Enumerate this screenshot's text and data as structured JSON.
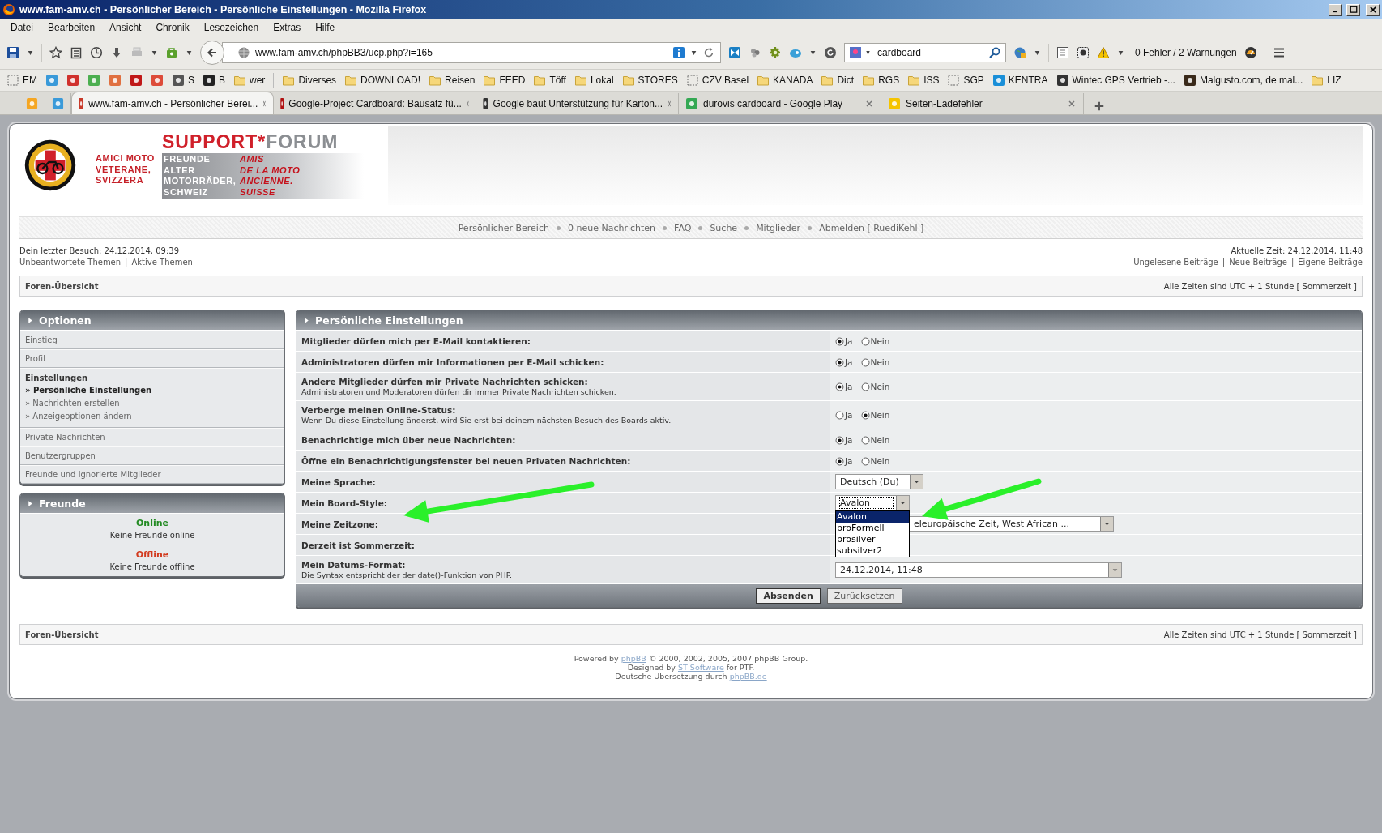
{
  "window": {
    "title": "www.fam-amv.ch - Persönlicher Bereich - Persönliche Einstellungen - Mozilla Firefox"
  },
  "menu": [
    "Datei",
    "Bearbeiten",
    "Ansicht",
    "Chronik",
    "Lesezeichen",
    "Extras",
    "Hilfe"
  ],
  "navigation_bar": {
    "url": "www.fam-amv.ch/phpBB3/ucp.php?i=165",
    "search": "cardboard",
    "status": "0 Fehler / 2 Warnungen"
  },
  "bookmarks": [
    {
      "kind": "page",
      "label": "EM"
    },
    {
      "kind": "site",
      "color": "#3a9ad9"
    },
    {
      "kind": "site",
      "color": "#d0312d"
    },
    {
      "kind": "site",
      "color": "#4caf50"
    },
    {
      "kind": "site",
      "color": "#e07040"
    },
    {
      "kind": "site",
      "color": "#c01818"
    },
    {
      "kind": "site",
      "color": "#dd4b39"
    },
    {
      "kind": "site",
      "color": "#555555",
      "label": "S"
    },
    {
      "kind": "site",
      "color": "#222222",
      "label": "B"
    },
    {
      "kind": "folder",
      "label": "wer"
    },
    {
      "kind": "folder",
      "label": "Diverses"
    },
    {
      "kind": "folder",
      "label": "DOWNLOAD!"
    },
    {
      "kind": "folder",
      "label": "Reisen"
    },
    {
      "kind": "folder",
      "label": "FEED"
    },
    {
      "kind": "folder",
      "label": "Töff"
    },
    {
      "kind": "folder",
      "label": "Lokal"
    },
    {
      "kind": "folder",
      "label": "STORES"
    },
    {
      "kind": "page",
      "label": "CZV Basel"
    },
    {
      "kind": "folder",
      "label": "KANADA"
    },
    {
      "kind": "folder",
      "label": "Dict"
    },
    {
      "kind": "folder",
      "label": "RGS"
    },
    {
      "kind": "folder",
      "label": "ISS"
    },
    {
      "kind": "page",
      "label": "SGP"
    },
    {
      "kind": "site",
      "color": "#1a8fd8",
      "label": "KENTRA"
    },
    {
      "kind": "site",
      "color": "#333333",
      "label": "Wintec GPS Vertrieb -..."
    },
    {
      "kind": "site",
      "color": "#3a2a1a",
      "label": "Malgusto.com, de mal..."
    },
    {
      "kind": "folder",
      "label": "LIZ"
    }
  ],
  "tabs": [
    {
      "kind": "pinned",
      "color": "#f5a623",
      "selected": false
    },
    {
      "kind": "pinned",
      "color": "#3a9ad9",
      "selected": false
    },
    {
      "kind": "page",
      "color": "#c83a2a",
      "label": "www.fam-amv.ch - Persönlicher Berei...",
      "selected": true
    },
    {
      "kind": "page",
      "color": "#b01010",
      "label": "Google-Project Cardboard: Bausatz fü...",
      "selected": false
    },
    {
      "kind": "page",
      "color": "#333333",
      "label": "Google baut Unterstützung für Karton...",
      "selected": false
    },
    {
      "kind": "page",
      "color": "#34a853",
      "label": "durovis cardboard - Google Play",
      "selected": false
    },
    {
      "kind": "page",
      "color": "#f5c400",
      "label": "Seiten-Ladefehler",
      "selected": false
    }
  ],
  "forum": {
    "logo": {
      "title_part_1": "SUPPORT*",
      "title_part_2": "FORUM",
      "italian": [
        "AMICI MOTO",
        "VETERANE,",
        "SVIZZERA"
      ],
      "german": [
        "FREUNDE",
        "ALTER",
        "MOTORRÄDER,",
        "SCHWEIZ"
      ],
      "french": [
        "AMIS",
        "DE LA MOTO",
        "ANCIENNE.",
        "SUISSE"
      ]
    },
    "nav_links": [
      "Persönlicher Bereich",
      "0 neue Nachrichten",
      "FAQ",
      "Suche",
      "Mitglieder",
      "Abmelden [ RuediKehl ]"
    ],
    "last_visit": "Dein letzter Besuch: 24.12.2014, 09:39",
    "current_time": "Aktuelle Zeit: 24.12.2014, 11:48",
    "link_separator": "|",
    "left_links": [
      "Unbeantwortete Themen",
      "Aktive Themen"
    ],
    "right_links": [
      "Ungelesene Beiträge",
      "Neue Beiträge",
      "Eigene Beiträge"
    ],
    "breadcrumb": "Foren-Übersicht",
    "timezone_note": "Alle Zeiten sind UTC + 1 Stunde [ Sommerzeit ]"
  },
  "sidebar": {
    "title": "Optionen",
    "items": [
      {
        "label": "Einstieg",
        "selected": false
      },
      {
        "label": "Profil",
        "selected": false
      },
      {
        "label": "Einstellungen",
        "selected": true,
        "children": [
          {
            "marker": "»",
            "label": "Persönliche Einstellungen",
            "selected": true
          },
          {
            "marker": "»",
            "label": "Nachrichten erstellen",
            "selected": false
          },
          {
            "marker": "»",
            "label": "Anzeigeoptionen ändern",
            "selected": false
          }
        ]
      },
      {
        "label": "Private Nachrichten",
        "selected": false
      },
      {
        "label": "Benutzergruppen",
        "selected": false
      },
      {
        "label": "Freunde und ignorierte Mitglieder",
        "selected": false
      }
    ]
  },
  "friends": {
    "title": "Freunde",
    "groups": [
      {
        "kind": "online",
        "heading": "Online",
        "text": "Keine Freunde online"
      },
      {
        "kind": "offline",
        "heading": "Offline",
        "text": "Keine Freunde offline"
      }
    ]
  },
  "settings": {
    "title": "Persönliche Einstellungen",
    "rows": [
      {
        "kind": "radio",
        "label": "Mitglieder dürfen mich per E-Mail kontaktieren:",
        "options": [
          {
            "label": "Ja",
            "selected": true
          },
          {
            "label": "Nein",
            "selected": false
          }
        ]
      },
      {
        "kind": "radio",
        "label": "Administratoren dürfen mir Informationen per E-Mail schicken:",
        "options": [
          {
            "label": "Ja",
            "selected": true
          },
          {
            "label": "Nein",
            "selected": false
          }
        ]
      },
      {
        "kind": "radio",
        "label": "Andere Mitglieder dürfen mir Private Nachrichten schicken:",
        "hint": "Administratoren und Moderatoren dürfen dir immer Private Nachrichten schicken.",
        "options": [
          {
            "label": "Ja",
            "selected": true
          },
          {
            "label": "Nein",
            "selected": false
          }
        ]
      },
      {
        "kind": "radio",
        "label": "Verberge meinen Online-Status:",
        "hint": "Wenn Du diese Einstellung änderst, wird Sie erst bei deinem nächsten Besuch des Boards aktiv.",
        "options": [
          {
            "label": "Ja",
            "selected": false
          },
          {
            "label": "Nein",
            "selected": true
          }
        ]
      },
      {
        "kind": "radio",
        "label": "Benachrichtige mich über neue Nachrichten:",
        "options": [
          {
            "label": "Ja",
            "selected": true
          },
          {
            "label": "Nein",
            "selected": false
          }
        ]
      },
      {
        "kind": "radio",
        "label": "Öffne ein Benachrichtigungsfenster bei neuen Privaten Nachrichten:",
        "options": [
          {
            "label": "Ja",
            "selected": true
          },
          {
            "label": "Nein",
            "selected": false
          }
        ]
      },
      {
        "kind": "select",
        "label": "Meine Sprache:",
        "value": "Deutsch (Du)",
        "expanded": false
      },
      {
        "kind": "select",
        "label": "Mein Board-Style:",
        "value": "Avalon",
        "expanded": true,
        "options": [
          {
            "label": "Avalon",
            "selected": true
          },
          {
            "label": "proFormell",
            "selected": false
          },
          {
            "label": "prosilver",
            "selected": false
          },
          {
            "label": "subsilver2",
            "selected": false
          }
        ]
      },
      {
        "kind": "select",
        "label": "Meine Zeitzone:",
        "value": "eleuropäische Zeit, West African ...",
        "expanded": false
      },
      {
        "kind": "plain",
        "label": "Derzeit ist Sommerzeit:"
      },
      {
        "kind": "select",
        "label": "Mein Datums-Format:",
        "hint": "Die Syntax entspricht der der date()-Funktion von PHP.",
        "value": "24.12.2014, 11:48",
        "expanded": false
      }
    ],
    "buttons": [
      {
        "label": "Absenden",
        "kind": "primary"
      },
      {
        "label": "Zurücksetzen",
        "kind": "secondary"
      }
    ]
  },
  "footer": {
    "breadcrumb": "Foren-Übersicht",
    "timezone_note": "Alle Zeiten sind UTC + 1 Stunde [ Sommerzeit ]",
    "credits": [
      [
        {
          "text": "Powered by ",
          "link": false
        },
        {
          "text": "phpBB",
          "link": true
        },
        {
          "text": " © 2000, 2002, 2005, 2007 phpBB Group.",
          "link": false
        }
      ],
      [
        {
          "text": "Designed by ",
          "link": false
        },
        {
          "text": "ST Software",
          "link": true
        },
        {
          "text": " for PTF.",
          "link": false
        }
      ],
      [
        {
          "text": "Deutsche Übersetzung durch ",
          "link": false
        },
        {
          "text": "phpBB.de",
          "link": true
        }
      ]
    ]
  }
}
